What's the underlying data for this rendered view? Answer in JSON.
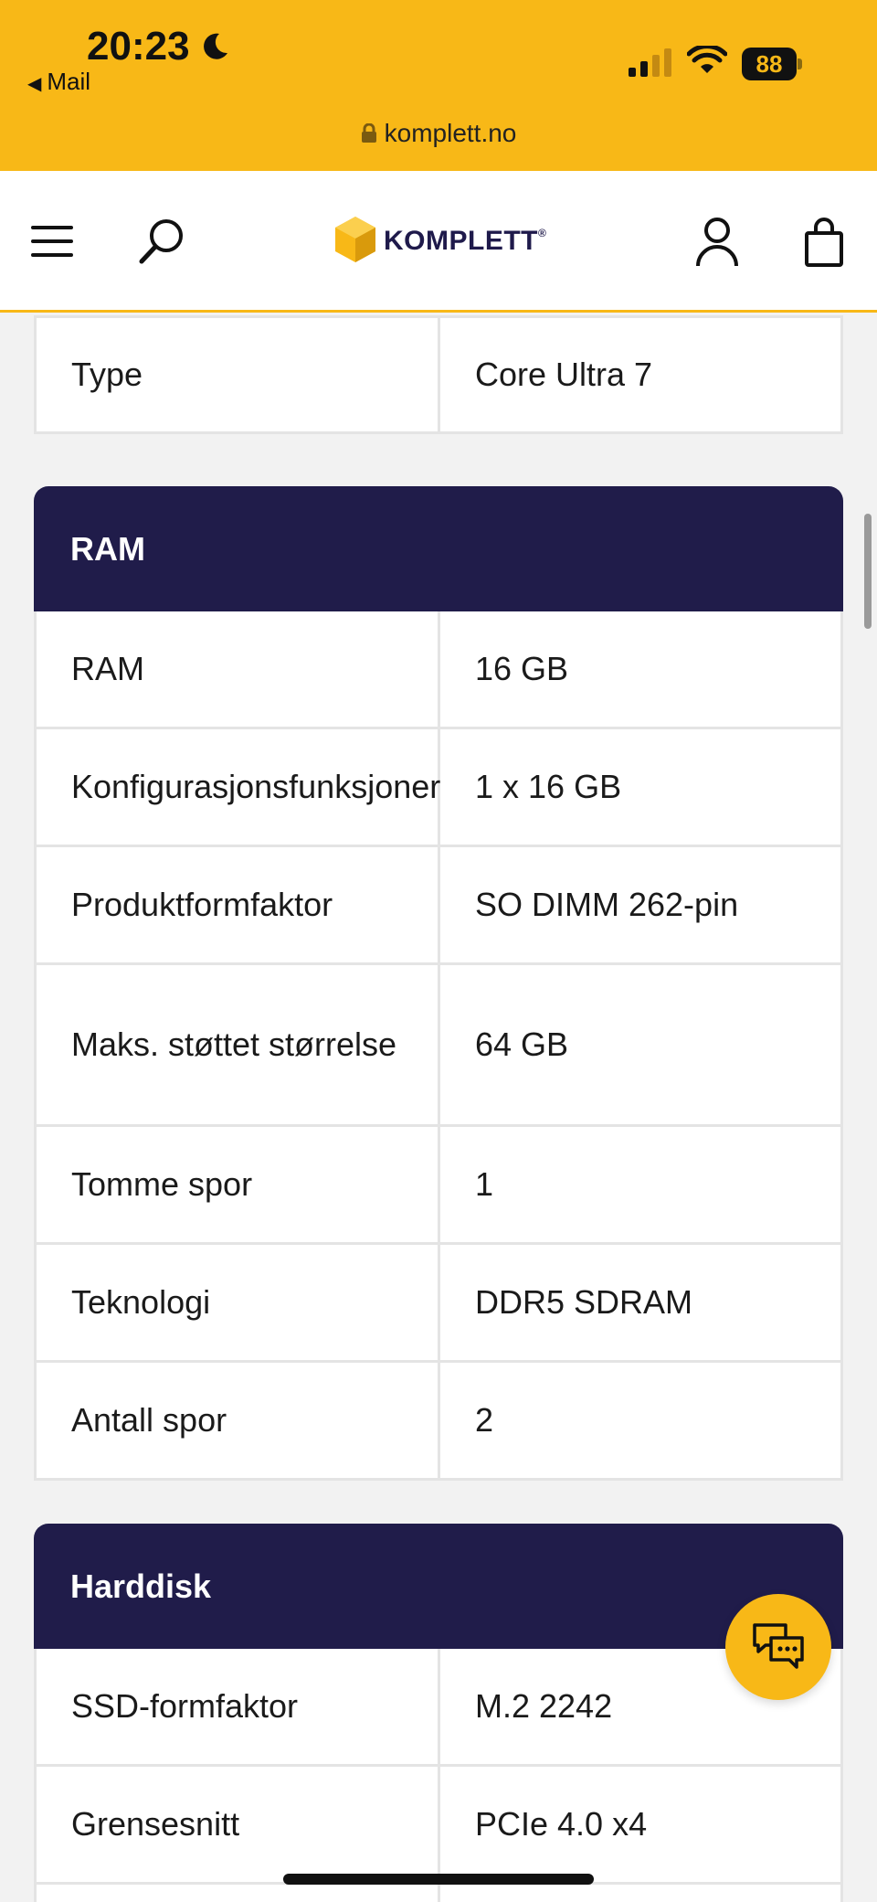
{
  "status_bar": {
    "time": "20:23",
    "back_label": "Mail",
    "battery": "88",
    "url": "komplett.no"
  },
  "nav": {
    "logo_text": "KOMPLETT",
    "logo_mark": "®"
  },
  "partial_section": {
    "rows": [
      {
        "key": "Type",
        "value": "Core Ultra 7"
      }
    ]
  },
  "ram_section": {
    "title": "RAM",
    "rows": [
      {
        "key": "RAM",
        "value": "16 GB"
      },
      {
        "key": "Konfigurasjonsfunksjoner",
        "value": "1 x 16 GB"
      },
      {
        "key": "Produktformfaktor",
        "value": "SO DIMM 262-pin"
      },
      {
        "key": "Maks. støttet størrelse",
        "value": "64 GB"
      },
      {
        "key": "Tomme spor",
        "value": "1"
      },
      {
        "key": "Teknologi",
        "value": "DDR5 SDRAM"
      },
      {
        "key": "Antall spor",
        "value": "2"
      }
    ]
  },
  "disk_section": {
    "title": "Harddisk",
    "rows": [
      {
        "key": "SSD-formfaktor",
        "value": "M.2 2242"
      },
      {
        "key": "Grensesnitt",
        "value": "PCIe 4.0 x4"
      }
    ]
  },
  "colors": {
    "brand_yellow": "#f8b817",
    "header_navy": "#201c4a"
  },
  "icons": {
    "chat": "chat-icon",
    "menu": "menu-icon",
    "search": "search-icon",
    "user": "user-icon",
    "cart": "cart-icon"
  }
}
